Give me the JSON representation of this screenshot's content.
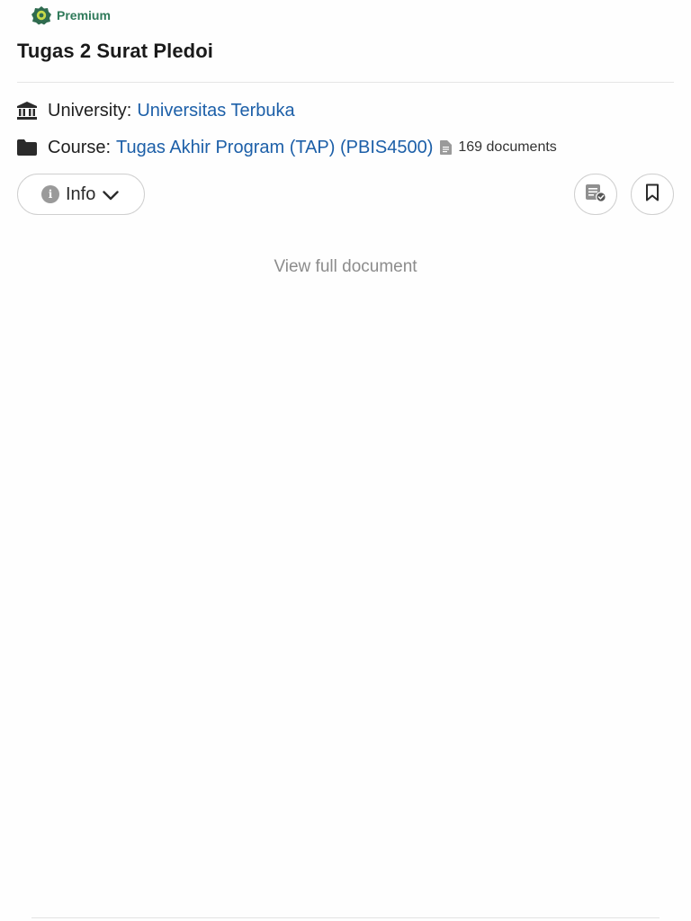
{
  "badge": {
    "label": "Premium",
    "icon": "premium-badge-icon",
    "color": "#2f7a5a"
  },
  "document": {
    "title": "Tugas 2 Surat Pledoi"
  },
  "meta": {
    "university": {
      "key": "University:",
      "value": "Universitas Terbuka",
      "icon": "university-icon"
    },
    "course": {
      "key": "Course:",
      "value": "Tugas Akhir Program (TAP) (PBIS4500)",
      "icon": "folder-icon",
      "document_count": "169 documents"
    },
    "link_color": "#1c5fa8"
  },
  "actions": {
    "info_label": "Info",
    "summary_icon": "document-check-icon",
    "bookmark_icon": "bookmark-icon"
  },
  "viewer": {
    "view_full_label": "View full document"
  }
}
